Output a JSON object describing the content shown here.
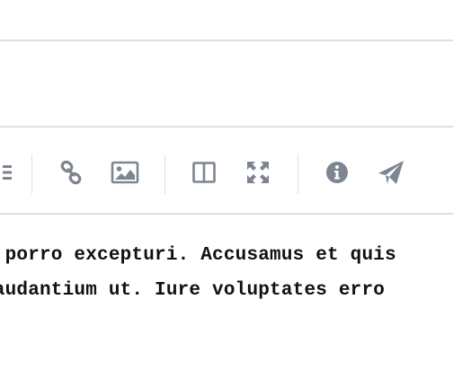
{
  "editor": {
    "lines": [
      "t porro excepturi. Accusamus et quis",
      " laudantium ut. Iure voluptates erro"
    ]
  },
  "toolbar": {
    "icons": [
      "list-icon",
      "link-icon",
      "image-icon",
      "side-by-side-icon",
      "fullscreen-icon",
      "info-icon",
      "send-icon"
    ],
    "icon_color": "#7d8590"
  },
  "colors": {
    "divider": "#dcdfe4",
    "text": "#111111",
    "background": "#ffffff"
  }
}
